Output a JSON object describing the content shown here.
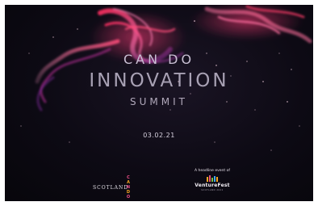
{
  "event": {
    "line1": "CAN DO",
    "line2": "INNOVATION",
    "line3": "SUMMIT",
    "date": "03.02.21"
  },
  "sponsor_scotland": {
    "text": "SCOTLAND",
    "stack_letters": [
      "C",
      "A",
      "N",
      "D",
      "O"
    ]
  },
  "sponsor_venturefest": {
    "headline": "A headline event of",
    "name": "VentureFest",
    "sub": "SCOTLAND 2021"
  },
  "colors": {
    "background": "#0d0a14",
    "smoke_pink": "#ff3b8a",
    "smoke_red": "#ff2d55",
    "title_text": "#b9b3c4",
    "accent_orange": "#f5a623"
  }
}
